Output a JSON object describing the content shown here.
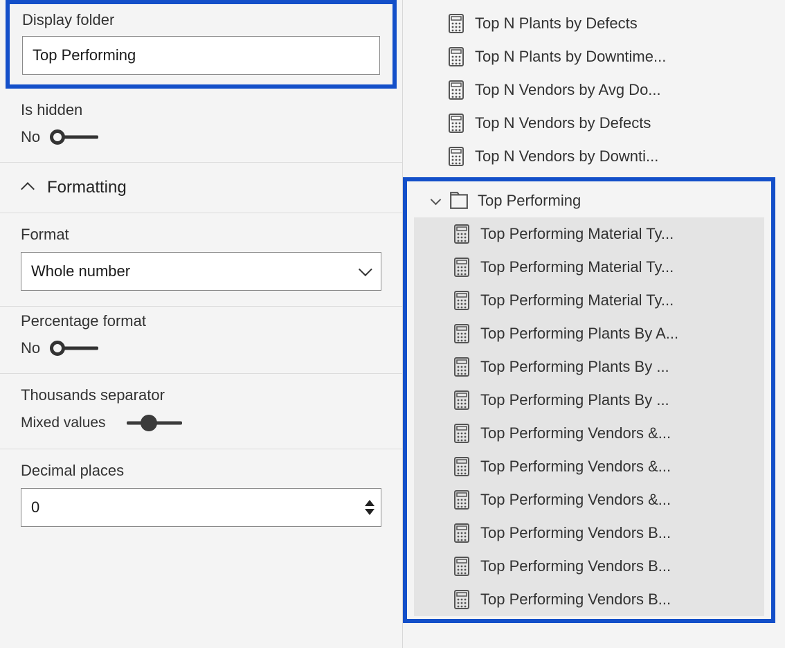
{
  "properties": {
    "display_folder_label": "Display folder",
    "display_folder_value": "Top Performing",
    "is_hidden_label": "Is hidden",
    "is_hidden_value": "No"
  },
  "formatting": {
    "section_title": "Formatting",
    "format_label": "Format",
    "format_value": "Whole number",
    "percentage_label": "Percentage format",
    "percentage_value": "No",
    "thousands_label": "Thousands separator",
    "thousands_value": "Mixed values",
    "decimal_places_label": "Decimal places",
    "decimal_places_value": "0"
  },
  "fields": {
    "top_list": [
      "Top N Plants by Defects",
      "Top N Plants by Downtime...",
      "Top N Vendors by Avg Do...",
      "Top N Vendors by Defects",
      "Top N Vendors by Downti..."
    ],
    "folder_name": "Top Performing",
    "folder_items": [
      "Top Performing Material Ty...",
      "Top Performing Material Ty...",
      "Top Performing Material Ty...",
      "Top Performing Plants By A...",
      "Top Performing Plants By ...",
      "Top Performing Plants By ...",
      "Top Performing Vendors &...",
      "Top Performing Vendors &...",
      "Top Performing Vendors &...",
      "Top Performing Vendors B...",
      "Top Performing Vendors B...",
      "Top Performing Vendors B..."
    ]
  }
}
